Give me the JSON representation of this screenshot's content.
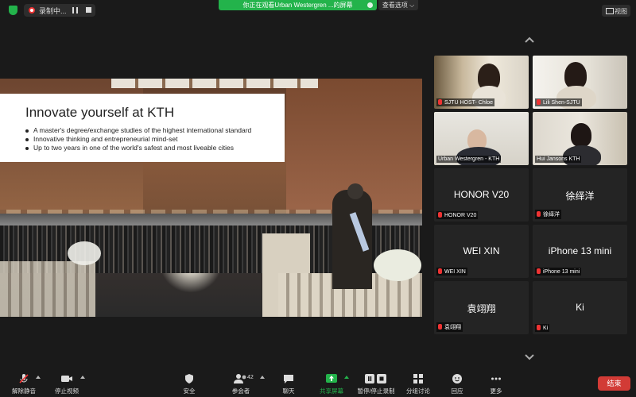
{
  "top_bar": {
    "recording_label": "录制中...",
    "share_banner": "你正在观看Urban Westergren ...的屏幕",
    "view_options": "查看选项 ⌵",
    "view_button": "视图"
  },
  "slide": {
    "title": "Innovate yourself at KTH",
    "bullets": [
      "A master's degree/exchange studies of the highest international standard",
      "Innovative thinking and entrepreneurial mind-set",
      "Up to two years in one of the world's safest and most liveable cities"
    ]
  },
  "gallery": {
    "tiles": [
      {
        "label": "SJTU HOST- Chloe",
        "type": "video"
      },
      {
        "label": "Lili Shen-SJTU",
        "type": "video"
      },
      {
        "label": "Urban Westergren - KTH",
        "type": "video",
        "active": true
      },
      {
        "label": "Hui Jansons KTH",
        "type": "video"
      },
      {
        "name": "HONOR V20",
        "label": "HONOR V20"
      },
      {
        "name": "徐绎洋",
        "label": "徐绎洋"
      },
      {
        "name": "WEI XIN",
        "label": "WEI XIN"
      },
      {
        "name": "iPhone 13 mini",
        "label": "iPhone 13 mini"
      },
      {
        "name": "袁翊翔",
        "label": "袁翊翔"
      },
      {
        "name": "Ki",
        "label": "Ki"
      }
    ]
  },
  "toolbar": {
    "unmute": "解除静音",
    "stop_video": "停止视频",
    "security": "安全",
    "participants": "参会者",
    "participants_count": "42",
    "chat": "聊天",
    "share_screen": "共享屏幕",
    "pause_record": "暂停/停止录制",
    "breakout": "分组讨论",
    "reactions": "回应",
    "more": "更多",
    "end": "结束"
  },
  "colors": {
    "accent_green": "#23b34b",
    "end_red": "#d23b36",
    "active_speaker": "#c9d86a"
  }
}
